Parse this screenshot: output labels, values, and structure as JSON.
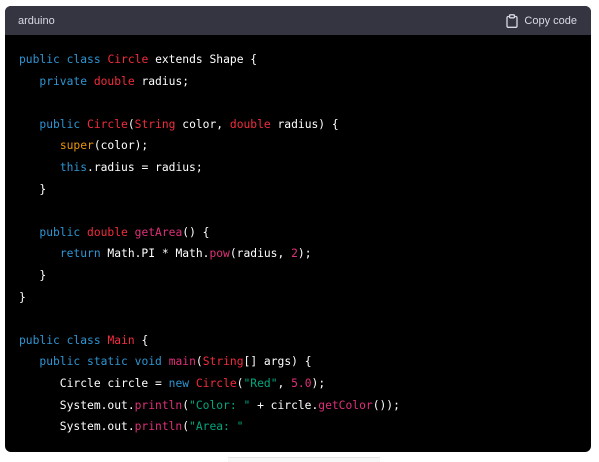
{
  "header": {
    "language": "arduino",
    "copy_label": "Copy code",
    "copy_icon": "clipboard-icon"
  },
  "colors": {
    "keyword": "#2e95d3",
    "class_name": "#f22c3d",
    "function": "#df3079",
    "string": "#00a67d",
    "number": "#df3079",
    "plain": "#ffffff",
    "super_call": "#e9950c",
    "background": "#000000",
    "header_background": "#343541"
  },
  "code": {
    "lines": [
      [
        {
          "t": "keyword",
          "v": "public"
        },
        {
          "t": "plain",
          "v": " "
        },
        {
          "t": "keyword",
          "v": "class"
        },
        {
          "t": "plain",
          "v": " "
        },
        {
          "t": "type",
          "v": "Circle"
        },
        {
          "t": "plain",
          "v": " "
        },
        {
          "t": "plain",
          "v": "extends Shape {"
        }
      ],
      [
        {
          "t": "plain",
          "v": "   "
        },
        {
          "t": "keyword",
          "v": "private"
        },
        {
          "t": "plain",
          "v": " "
        },
        {
          "t": "type",
          "v": "double"
        },
        {
          "t": "plain",
          "v": " radius;"
        }
      ],
      [],
      [
        {
          "t": "plain",
          "v": "   "
        },
        {
          "t": "keyword",
          "v": "public"
        },
        {
          "t": "plain",
          "v": " "
        },
        {
          "t": "type",
          "v": "Circle"
        },
        {
          "t": "plain",
          "v": "("
        },
        {
          "t": "type",
          "v": "String"
        },
        {
          "t": "plain",
          "v": " color, "
        },
        {
          "t": "type",
          "v": "double"
        },
        {
          "t": "plain",
          "v": " radius) {"
        }
      ],
      [
        {
          "t": "plain",
          "v": "      "
        },
        {
          "t": "super",
          "v": "super"
        },
        {
          "t": "plain",
          "v": "(color);"
        }
      ],
      [
        {
          "t": "plain",
          "v": "      "
        },
        {
          "t": "keyword",
          "v": "this"
        },
        {
          "t": "plain",
          "v": ".radius = radius;"
        }
      ],
      [
        {
          "t": "plain",
          "v": "   }"
        }
      ],
      [],
      [
        {
          "t": "plain",
          "v": "   "
        },
        {
          "t": "keyword",
          "v": "public"
        },
        {
          "t": "plain",
          "v": " "
        },
        {
          "t": "type",
          "v": "double"
        },
        {
          "t": "plain",
          "v": " "
        },
        {
          "t": "func",
          "v": "getArea"
        },
        {
          "t": "plain",
          "v": "() {"
        }
      ],
      [
        {
          "t": "plain",
          "v": "      "
        },
        {
          "t": "keyword",
          "v": "return"
        },
        {
          "t": "plain",
          "v": " Math.PI * Math."
        },
        {
          "t": "func",
          "v": "pow"
        },
        {
          "t": "plain",
          "v": "(radius, "
        },
        {
          "t": "number",
          "v": "2"
        },
        {
          "t": "plain",
          "v": ");"
        }
      ],
      [
        {
          "t": "plain",
          "v": "   }"
        }
      ],
      [
        {
          "t": "plain",
          "v": "}"
        }
      ],
      [],
      [
        {
          "t": "keyword",
          "v": "public"
        },
        {
          "t": "plain",
          "v": " "
        },
        {
          "t": "keyword",
          "v": "class"
        },
        {
          "t": "plain",
          "v": " "
        },
        {
          "t": "type",
          "v": "Main"
        },
        {
          "t": "plain",
          "v": " {"
        }
      ],
      [
        {
          "t": "plain",
          "v": "   "
        },
        {
          "t": "keyword",
          "v": "public"
        },
        {
          "t": "plain",
          "v": " "
        },
        {
          "t": "keyword",
          "v": "static"
        },
        {
          "t": "plain",
          "v": " "
        },
        {
          "t": "keyword",
          "v": "void"
        },
        {
          "t": "plain",
          "v": " "
        },
        {
          "t": "func",
          "v": "main"
        },
        {
          "t": "plain",
          "v": "("
        },
        {
          "t": "type",
          "v": "String"
        },
        {
          "t": "plain",
          "v": "[] args) {"
        }
      ],
      [
        {
          "t": "plain",
          "v": "      Circle circle = "
        },
        {
          "t": "keyword",
          "v": "new"
        },
        {
          "t": "plain",
          "v": " "
        },
        {
          "t": "type",
          "v": "Circle"
        },
        {
          "t": "plain",
          "v": "("
        },
        {
          "t": "string",
          "v": "\"Red\""
        },
        {
          "t": "plain",
          "v": ", "
        },
        {
          "t": "number",
          "v": "5.0"
        },
        {
          "t": "plain",
          "v": ");"
        }
      ],
      [
        {
          "t": "plain",
          "v": "      System.out."
        },
        {
          "t": "func",
          "v": "println"
        },
        {
          "t": "plain",
          "v": "("
        },
        {
          "t": "string",
          "v": "\"Color: \""
        },
        {
          "t": "plain",
          "v": " + circle."
        },
        {
          "t": "func",
          "v": "getColor"
        },
        {
          "t": "plain",
          "v": "());"
        }
      ],
      [
        {
          "t": "plain",
          "v": "      System.out."
        },
        {
          "t": "func",
          "v": "println"
        },
        {
          "t": "plain",
          "v": "("
        },
        {
          "t": "string",
          "v": "\"Area: \""
        }
      ]
    ]
  }
}
